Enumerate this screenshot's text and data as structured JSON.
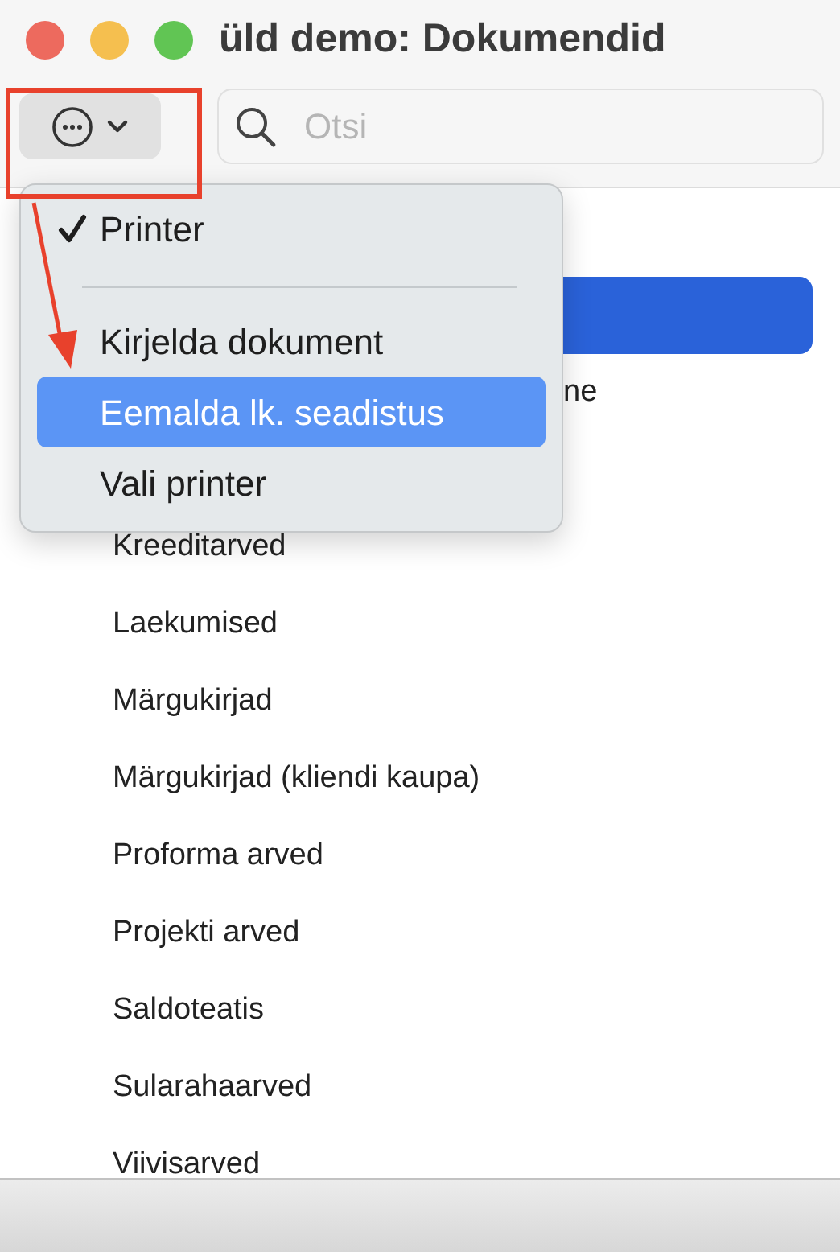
{
  "window": {
    "title": "üld demo: Dokumendid"
  },
  "toolbar": {
    "search": {
      "placeholder": "Otsi"
    }
  },
  "list": {
    "rows": [
      {
        "selected": false
      },
      {
        "selected": true
      },
      {
        "text": "ne",
        "kind": "partial",
        "selected": false
      },
      {
        "selected": false
      },
      {
        "text": "Kreeditarved",
        "kind": "full",
        "selected": false
      },
      {
        "text": "Laekumised",
        "kind": "full",
        "selected": false
      },
      {
        "text": "Märgukirjad",
        "kind": "full",
        "selected": false
      },
      {
        "text": "Märgukirjad (kliendi kaupa)",
        "kind": "full",
        "selected": false
      },
      {
        "text": "Proforma arved",
        "kind": "full",
        "selected": false
      },
      {
        "text": "Projekti arved",
        "kind": "full",
        "selected": false
      },
      {
        "text": "Saldoteatis",
        "kind": "full",
        "selected": false
      },
      {
        "text": "Sularahaarved",
        "kind": "full",
        "selected": false
      },
      {
        "text": "Viivisarved",
        "kind": "full",
        "selected": false
      }
    ]
  },
  "menu": {
    "items": [
      {
        "kind": "item",
        "label": "Printer",
        "checked": true,
        "selected": false
      },
      {
        "kind": "separator"
      },
      {
        "kind": "item",
        "label": "Kirjelda dokument",
        "checked": false,
        "selected": false
      },
      {
        "kind": "item",
        "label": "Eemalda lk. seadistus",
        "checked": false,
        "selected": true
      },
      {
        "kind": "item",
        "label": "Vali printer",
        "checked": false,
        "selected": false
      }
    ]
  }
}
